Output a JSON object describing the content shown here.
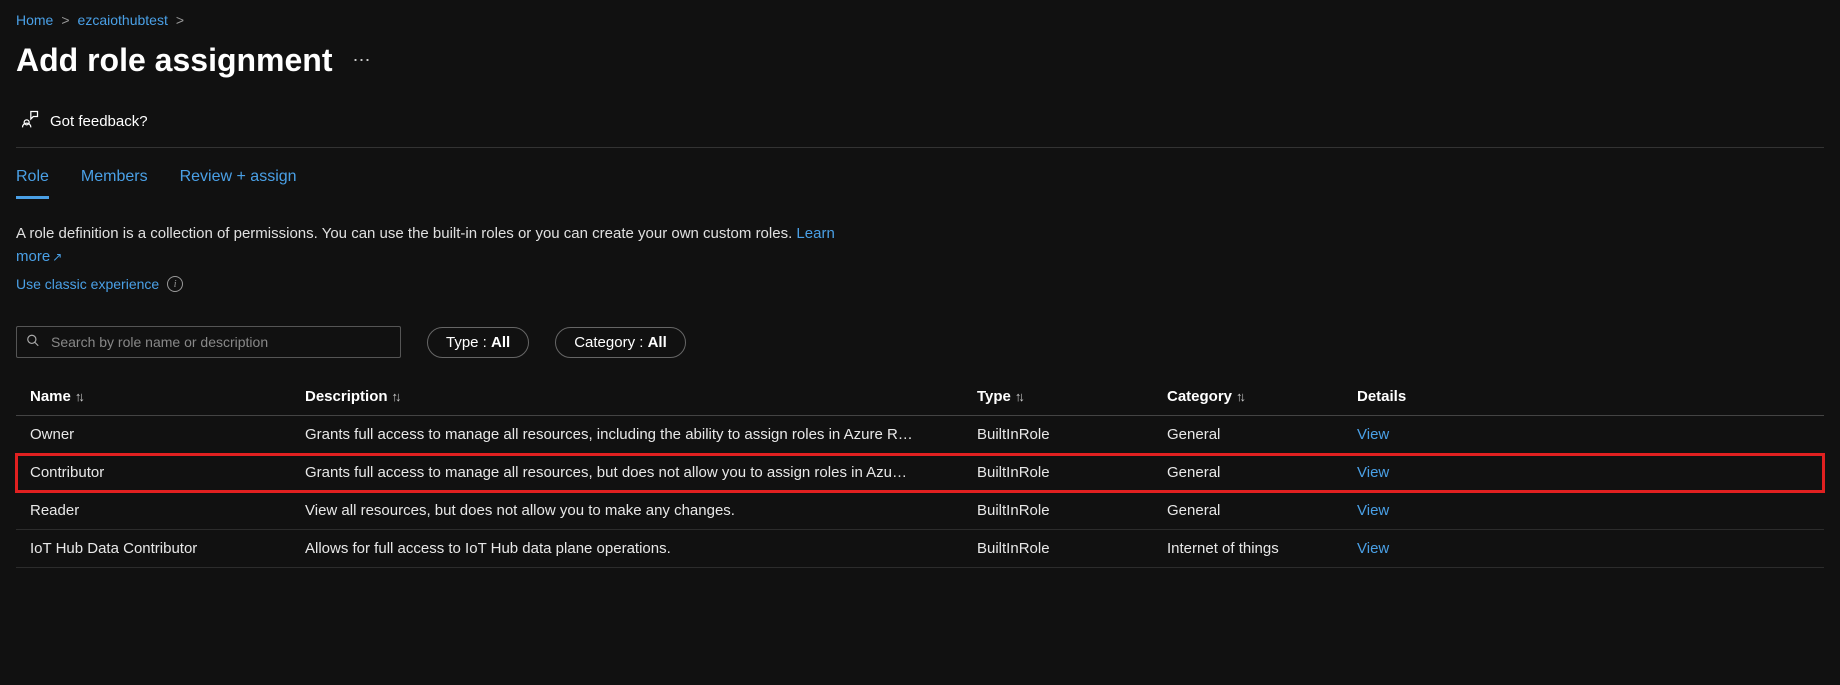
{
  "breadcrumb": {
    "items": [
      "Home",
      "ezcaiothubtest"
    ]
  },
  "page_title": "Add role assignment",
  "feedback_label": "Got feedback?",
  "tabs": [
    {
      "label": "Role",
      "active": true
    },
    {
      "label": "Members",
      "active": false
    },
    {
      "label": "Review + assign",
      "active": false
    }
  ],
  "description": "A role definition is a collection of permissions. You can use the built-in roles or you can create your own custom roles. ",
  "learn_more_label": "Learn more",
  "classic_link": "Use classic experience",
  "search": {
    "placeholder": "Search by role name or description"
  },
  "filters": {
    "type_label": "Type : ",
    "type_value": "All",
    "category_label": "Category : ",
    "category_value": "All"
  },
  "columns": {
    "name": "Name",
    "description": "Description",
    "type": "Type",
    "category": "Category",
    "details": "Details"
  },
  "rows": [
    {
      "name": "Owner",
      "description": "Grants full access to manage all resources, including the ability to assign roles in Azure R…",
      "type": "BuiltInRole",
      "category": "General",
      "details": "View",
      "highlighted": false
    },
    {
      "name": "Contributor",
      "description": "Grants full access to manage all resources, but does not allow you to assign roles in Azu…",
      "type": "BuiltInRole",
      "category": "General",
      "details": "View",
      "highlighted": true
    },
    {
      "name": "Reader",
      "description": "View all resources, but does not allow you to make any changes.",
      "type": "BuiltInRole",
      "category": "General",
      "details": "View",
      "highlighted": false
    },
    {
      "name": "IoT Hub Data Contributor",
      "description": "Allows for full access to IoT Hub data plane operations.",
      "type": "BuiltInRole",
      "category": "Internet of things",
      "details": "View",
      "highlighted": false
    }
  ]
}
